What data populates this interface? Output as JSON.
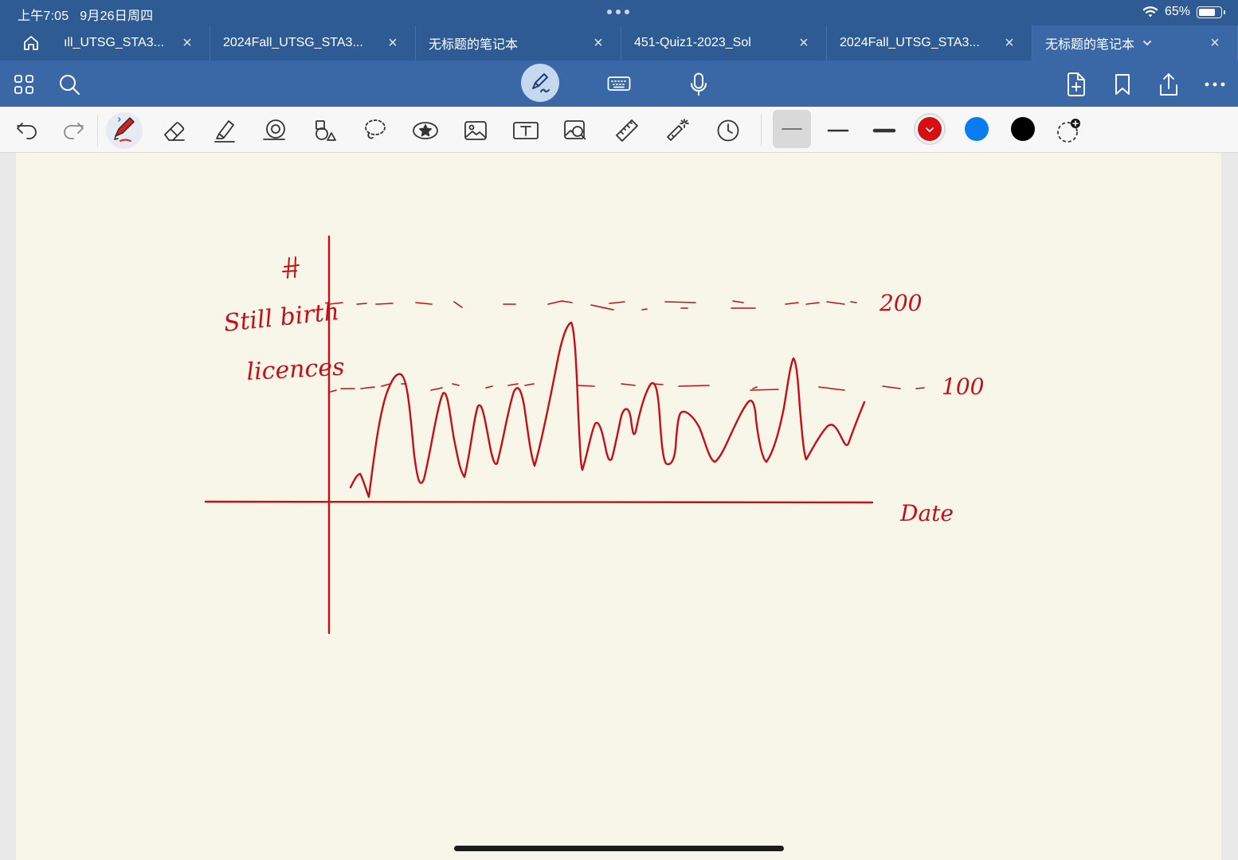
{
  "status_bar": {
    "time": "上午7:05",
    "date": "9月26日周四",
    "battery": "65%"
  },
  "tabs": [
    {
      "label": "ıll_UTSG_STA3...",
      "active": false
    },
    {
      "label": "2024Fall_UTSG_STA3...",
      "active": false
    },
    {
      "label": "无标题的笔记本",
      "active": false
    },
    {
      "label": "451-Quiz1-2023_Sol",
      "active": false
    },
    {
      "label": "2024Fall_UTSG_STA3...",
      "active": false
    },
    {
      "label": "无标题的笔记本",
      "active": true
    }
  ],
  "toolbar": {
    "left_icons": [
      "grid-icon",
      "search-icon"
    ],
    "center_icons": [
      "pen-mode-icon",
      "keyboard-icon",
      "microphone-icon"
    ],
    "right_icons": [
      "add-page-icon",
      "bookmark-icon",
      "share-icon",
      "more-icon"
    ]
  },
  "tools": [
    "undo-icon",
    "redo-icon",
    "pen-tool-icon",
    "eraser-icon",
    "highlighter-icon",
    "shape-icon",
    "element-icon",
    "lasso-icon",
    "sticker-icon",
    "image-icon",
    "text-box-icon",
    "zoom-window-icon",
    "ruler-icon",
    "laser-pointer-icon",
    "timer-icon"
  ],
  "colors": {
    "accent": "#2f5b94",
    "ink": "#c40f14",
    "swatch_red": "#d50f12",
    "swatch_blue": "#0a7cf0",
    "swatch_black": "#000000",
    "paper": "#f8f5e9"
  },
  "note": {
    "y_label_hash": "#",
    "y_label_line1": "Still birth",
    "y_label_line2": "licences",
    "level_200": "200",
    "level_100": "100",
    "x_label": "Date"
  }
}
